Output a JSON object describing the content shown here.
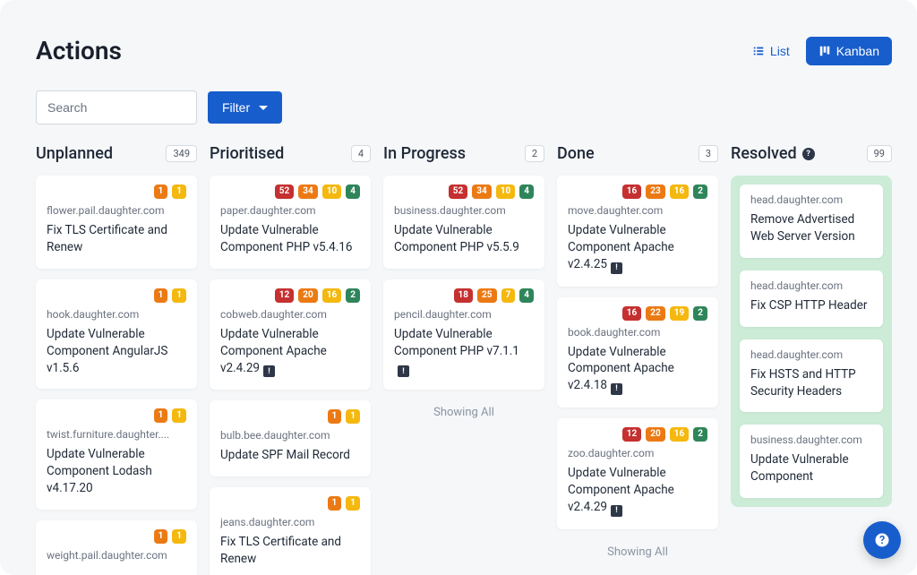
{
  "header": {
    "title": "Actions",
    "list_label": "List",
    "kanban_label": "Kanban"
  },
  "controls": {
    "search_placeholder": "Search",
    "filter_label": "Filter"
  },
  "columns": [
    {
      "title": "Unplanned",
      "count": "349",
      "help": false,
      "resolved": false,
      "show_all_label": null,
      "cards": [
        {
          "badges": [
            {
              "v": "1",
              "c": "orange"
            },
            {
              "v": "1",
              "c": "yellow"
            }
          ],
          "host": "flower.pail.daughter.com",
          "text": "Fix TLS Certificate and Renew",
          "note": false
        },
        {
          "badges": [
            {
              "v": "1",
              "c": "orange"
            },
            {
              "v": "1",
              "c": "yellow"
            }
          ],
          "host": "hook.daughter.com",
          "text": "Update Vulnerable Component AngularJS v1.5.6",
          "note": false
        },
        {
          "badges": [
            {
              "v": "1",
              "c": "orange"
            },
            {
              "v": "1",
              "c": "yellow"
            }
          ],
          "host": "twist.furniture.daughter....",
          "text": "Update Vulnerable Component Lodash v4.17.20",
          "note": false
        },
        {
          "badges": [
            {
              "v": "1",
              "c": "orange"
            },
            {
              "v": "1",
              "c": "yellow"
            }
          ],
          "host": "weight.pail.daughter.com",
          "text": "",
          "note": false
        }
      ]
    },
    {
      "title": "Prioritised",
      "count": "4",
      "help": false,
      "resolved": false,
      "show_all_label": null,
      "cards": [
        {
          "badges": [
            {
              "v": "52",
              "c": "red"
            },
            {
              "v": "34",
              "c": "orange"
            },
            {
              "v": "10",
              "c": "yellow"
            },
            {
              "v": "4",
              "c": "green"
            }
          ],
          "host": "paper.daughter.com",
          "text": "Update Vulnerable Component PHP v5.4.16",
          "note": false
        },
        {
          "badges": [
            {
              "v": "12",
              "c": "red"
            },
            {
              "v": "20",
              "c": "orange"
            },
            {
              "v": "16",
              "c": "yellow"
            },
            {
              "v": "2",
              "c": "green"
            }
          ],
          "host": "cobweb.daughter.com",
          "text": "Update Vulnerable Component Apache v2.4.29",
          "note": true
        },
        {
          "badges": [
            {
              "v": "1",
              "c": "orange"
            },
            {
              "v": "1",
              "c": "yellow"
            }
          ],
          "host": "bulb.bee.daughter.com",
          "text": "Update SPF Mail Record",
          "note": false
        },
        {
          "badges": [
            {
              "v": "1",
              "c": "orange"
            },
            {
              "v": "1",
              "c": "yellow"
            }
          ],
          "host": "jeans.daughter.com",
          "text": "Fix TLS Certificate and Renew",
          "note": false
        }
      ]
    },
    {
      "title": "In Progress",
      "count": "2",
      "help": false,
      "resolved": false,
      "show_all_label": "Showing All",
      "cards": [
        {
          "badges": [
            {
              "v": "52",
              "c": "red"
            },
            {
              "v": "34",
              "c": "orange"
            },
            {
              "v": "10",
              "c": "yellow"
            },
            {
              "v": "4",
              "c": "green"
            }
          ],
          "host": "business.daughter.com",
          "text": "Update Vulnerable Component PHP v5.5.9",
          "note": false
        },
        {
          "badges": [
            {
              "v": "18",
              "c": "red"
            },
            {
              "v": "25",
              "c": "orange"
            },
            {
              "v": "7",
              "c": "yellow"
            },
            {
              "v": "4",
              "c": "green"
            }
          ],
          "host": "pencil.daughter.com",
          "text": "Update Vulnerable Component PHP v7.1.1",
          "note": true
        }
      ]
    },
    {
      "title": "Done",
      "count": "3",
      "help": false,
      "resolved": false,
      "show_all_label": "Showing All",
      "cards": [
        {
          "badges": [
            {
              "v": "16",
              "c": "red"
            },
            {
              "v": "23",
              "c": "orange"
            },
            {
              "v": "16",
              "c": "yellow"
            },
            {
              "v": "2",
              "c": "green"
            }
          ],
          "host": "move.daughter.com",
          "text": "Update Vulnerable Component Apache v2.4.25",
          "note": true
        },
        {
          "badges": [
            {
              "v": "16",
              "c": "red"
            },
            {
              "v": "22",
              "c": "orange"
            },
            {
              "v": "19",
              "c": "yellow"
            },
            {
              "v": "2",
              "c": "green"
            }
          ],
          "host": "book.daughter.com",
          "text": "Update Vulnerable Component Apache v2.4.18",
          "note": true
        },
        {
          "badges": [
            {
              "v": "12",
              "c": "red"
            },
            {
              "v": "20",
              "c": "orange"
            },
            {
              "v": "16",
              "c": "yellow"
            },
            {
              "v": "2",
              "c": "green"
            }
          ],
          "host": "zoo.daughter.com",
          "text": "Update Vulnerable Component Apache v2.4.29",
          "note": true
        }
      ]
    },
    {
      "title": "Resolved",
      "count": "99",
      "help": true,
      "resolved": true,
      "show_all_label": null,
      "cards": [
        {
          "badges": [],
          "host": "head.daughter.com",
          "text": "Remove Advertised Web Server Version",
          "note": false
        },
        {
          "badges": [],
          "host": "head.daughter.com",
          "text": "Fix CSP HTTP Header",
          "note": false
        },
        {
          "badges": [],
          "host": "head.daughter.com",
          "text": "Fix HSTS and HTTP Security Headers",
          "note": false
        },
        {
          "badges": [],
          "host": "business.daughter.com",
          "text": "Update Vulnerable Component",
          "note": false
        }
      ]
    }
  ]
}
